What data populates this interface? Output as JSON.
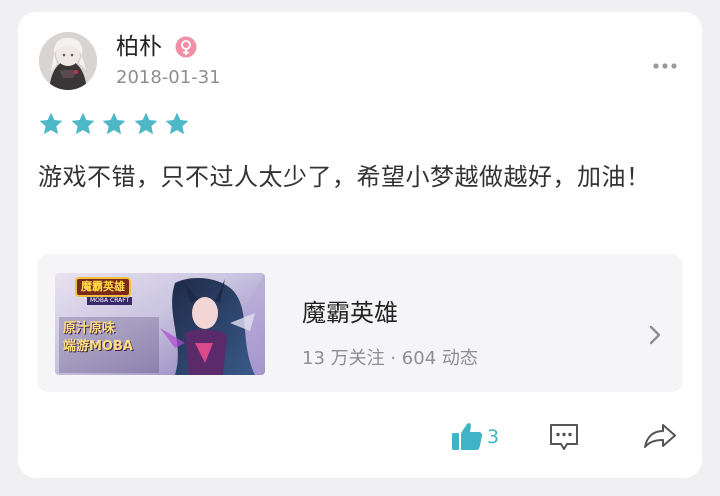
{
  "review": {
    "username": "柏朴",
    "date": "2018-01-31",
    "rating": 5,
    "text": "游戏不错，只不过人太少了，希望小梦越做越好，加油！"
  },
  "game": {
    "name": "魔霸英雄",
    "stats": "13 万关注 · 604 动态",
    "thumb_texts": {
      "logo": "魔霸英雄",
      "logo_sub": "MOBA CRAFT",
      "tagline_1": "原汁原味",
      "tagline_2": "端游MOBA"
    }
  },
  "actions": {
    "like_count": "3"
  },
  "colors": {
    "accent": "#3fb4c6",
    "star": "#4fb8c8",
    "female_badge": "#f08fa6",
    "card_bg": "#ffffff",
    "page_bg": "#f0f0f2",
    "game_card_bg": "#f5f5f7"
  },
  "icons": {
    "gender": "female-icon",
    "more": "more-dots-icon",
    "star": "star-icon",
    "chevron": "chevron-right-icon",
    "like": "thumbs-up-icon",
    "comment": "comment-icon",
    "share": "share-icon"
  }
}
